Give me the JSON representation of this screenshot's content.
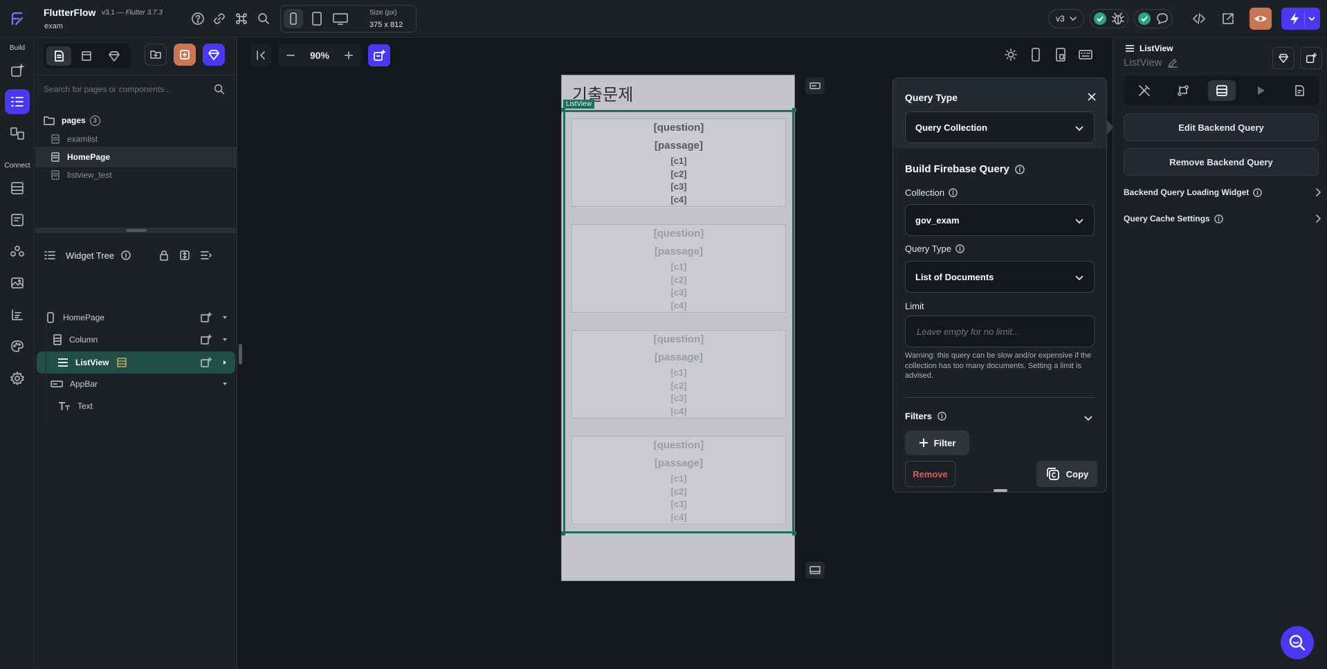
{
  "topbar": {
    "app_name": "FlutterFlow",
    "version": "v3.1 —",
    "flutter_version": "Flutter 3.7.3",
    "project": "exam",
    "size_label": "Size (px)",
    "size_value": "375 x 812",
    "branch": "v3"
  },
  "rail": {
    "build_label": "Build",
    "connect_label": "Connect"
  },
  "left_panel": {
    "search_placeholder": "Search for pages or components...",
    "pages_label": "pages",
    "pages_count": "3",
    "pages": [
      {
        "name": "examlist"
      },
      {
        "name": "HomePage"
      },
      {
        "name": "listview_test"
      }
    ],
    "widget_tree_title": "Widget Tree",
    "tree": [
      {
        "name": "HomePage"
      },
      {
        "name": "Column"
      },
      {
        "name": "ListView"
      },
      {
        "name": "AppBar"
      },
      {
        "name": "Text"
      }
    ]
  },
  "canvas": {
    "zoom": "90%",
    "phone_title": "기출문제",
    "listview_tag": "ListView",
    "card_lines": [
      "[question]",
      "[passage]",
      "[c1]",
      "[c2]",
      "[c3]",
      "[c4]"
    ]
  },
  "popup": {
    "title": "Query Type",
    "query_type_value": "Query Collection",
    "section_title": "Build Firebase Query",
    "collection_label": "Collection",
    "collection_value": "gov_exam",
    "query_type_label": "Query Type",
    "query_type_select": "List of Documents",
    "limit_label": "Limit",
    "limit_placeholder": "Leave empty for no limit...",
    "warning": "Warning: this query can be slow and/or expensive if the collection has too many documents. Setting a limit is advised.",
    "filters_label": "Filters",
    "filter_button": "Filter",
    "remove_button": "Remove",
    "copy_button": "Copy"
  },
  "right_panel": {
    "widget_type": "ListView",
    "widget_name": "ListView",
    "edit_backend": "Edit Backend Query",
    "remove_backend": "Remove Backend Query",
    "loading_widget": "Backend Query Loading Widget",
    "cache_settings": "Query Cache Settings"
  },
  "colors": {
    "accent": "#4b39ef",
    "selection": "#1f6b5c",
    "orange": "#c87656",
    "green": "#2ba08a",
    "danger": "#e05a5a"
  }
}
